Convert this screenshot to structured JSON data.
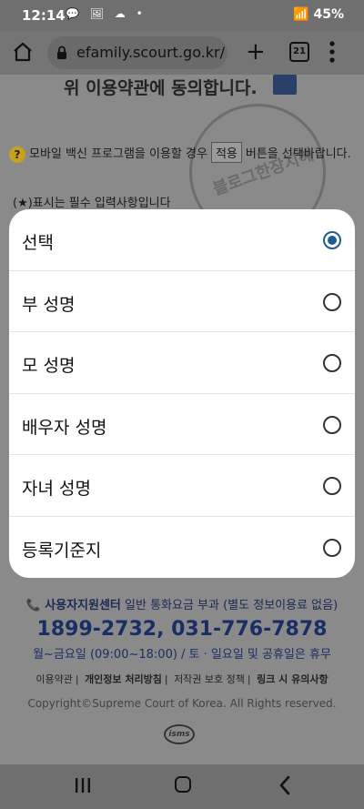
{
  "status_bar": {
    "time": "12:14",
    "notif_icons": "💬 🖼 ☁ •",
    "signal": "📶",
    "battery": "45%"
  },
  "browser": {
    "url": "efamily.scourt.go.kr/",
    "tab_count": "21"
  },
  "page": {
    "agree_text": "위 이용약관에 동의합니다.",
    "notice_pre": "모바일 백신 프로그램을 이용할 경우",
    "notice_btn": "적용",
    "notice_post": "버튼을 선택바랍니다.",
    "required_note": "(★)표시는 필수 입력사항입니다",
    "watermark": "블로그한장지혜",
    "support_label": "사용자지원센터",
    "support_note": "일반 통화요금 부과 (별도 정보이용료 없음)",
    "phone": "1899-2732, 031-776-7878",
    "hours": "월~금요일 (09:00~18:00) / 토 · 일요일 및 공휴일은 휴무",
    "links": [
      "이용약관",
      "개인정보 처리방침",
      "저작권 보호 정책",
      "링크 시 유의사항"
    ],
    "copyright": "Copyright©Supreme Court of Korea. All Rights reserved.",
    "isms": "isms"
  },
  "dialog": {
    "options": [
      {
        "label": "선택",
        "selected": true
      },
      {
        "label": "부 성명",
        "selected": false
      },
      {
        "label": "모 성명",
        "selected": false
      },
      {
        "label": "배우자 성명",
        "selected": false
      },
      {
        "label": "자녀 성명",
        "selected": false
      },
      {
        "label": "등록기준지",
        "selected": false
      }
    ]
  },
  "colors": {
    "accent": "#1f5c8f",
    "overlay": "#8a8a8a"
  }
}
